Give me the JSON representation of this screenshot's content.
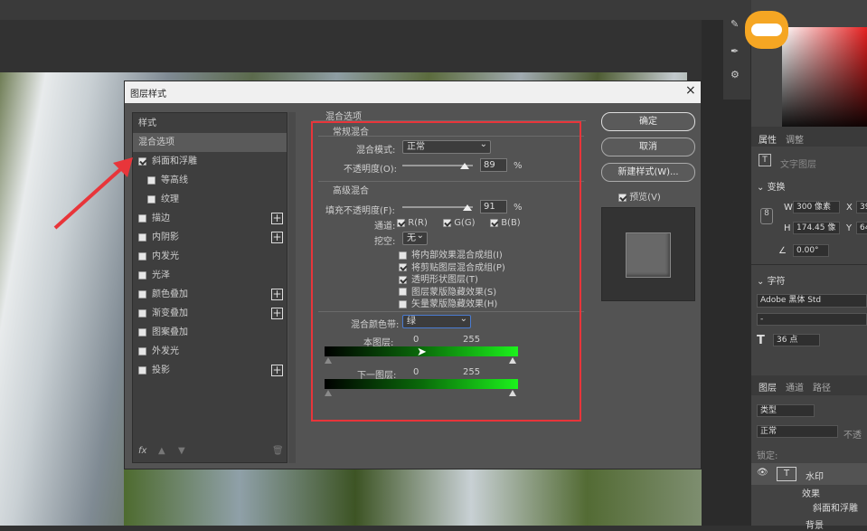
{
  "dialog": {
    "title": "图层样式",
    "close": "×",
    "styles_header": "样式",
    "blend_options": "混合选项",
    "items": [
      {
        "label": "斜面和浮雕",
        "checked": true,
        "plus": false,
        "indent": 0
      },
      {
        "label": "等高线",
        "checked": false,
        "plus": false,
        "indent": 1
      },
      {
        "label": "纹理",
        "checked": false,
        "plus": false,
        "indent": 1
      },
      {
        "label": "描边",
        "checked": false,
        "plus": true,
        "indent": 0
      },
      {
        "label": "内阴影",
        "checked": false,
        "plus": true,
        "indent": 0
      },
      {
        "label": "内发光",
        "checked": false,
        "plus": false,
        "indent": 0
      },
      {
        "label": "光泽",
        "checked": false,
        "plus": false,
        "indent": 0
      },
      {
        "label": "颜色叠加",
        "checked": false,
        "plus": true,
        "indent": 0
      },
      {
        "label": "渐变叠加",
        "checked": false,
        "plus": true,
        "indent": 0
      },
      {
        "label": "图案叠加",
        "checked": false,
        "plus": false,
        "indent": 0
      },
      {
        "label": "外发光",
        "checked": false,
        "plus": false,
        "indent": 0
      },
      {
        "label": "投影",
        "checked": false,
        "plus": true,
        "indent": 0
      }
    ],
    "fx": "fx",
    "section_title": "混合选项",
    "general": {
      "title": "常规混合",
      "mode_label": "混合模式:",
      "mode_value": "正常",
      "opacity_label": "不透明度(O):",
      "opacity_value": "89",
      "unit": "%"
    },
    "advanced": {
      "title": "高级混合",
      "fill_label": "填充不透明度(F):",
      "fill_value": "91",
      "unit": "%",
      "channels_label": "通道:",
      "channels": [
        "R(R)",
        "G(G)",
        "B(B)"
      ],
      "knockout_label": "挖空:",
      "knockout_value": "无",
      "options": [
        {
          "label": "将内部效果混合成组(I)",
          "checked": false
        },
        {
          "label": "将剪贴图层混合成组(P)",
          "checked": true
        },
        {
          "label": "透明形状图层(T)",
          "checked": true
        },
        {
          "label": "图层蒙版隐藏效果(S)",
          "checked": false
        },
        {
          "label": "矢量蒙版隐藏效果(H)",
          "checked": false
        }
      ]
    },
    "blend_if": {
      "label": "混合颜色带:",
      "value": "绿",
      "this_layer": "本图层:",
      "under_layer": "下一图层:",
      "min": "0",
      "max": "255"
    },
    "buttons": {
      "ok": "确定",
      "cancel": "取消",
      "new_style": "新建样式(W)...",
      "preview": "预览(V)"
    }
  },
  "right_panel": {
    "tab_properties": "属性",
    "tab_adjust": "调整",
    "text_layer": "文字图层",
    "transform": "变换",
    "w_label": "W",
    "w_value": "300 像素",
    "x_label": "X",
    "x_value": "39",
    "h_label": "H",
    "h_value": "174.45 像",
    "y_label": "Y",
    "y_value": "64",
    "angle": "0.00°",
    "char_title": "字符",
    "font": "Adobe 黑体 Std",
    "font_style": "-",
    "size": "36 点",
    "layers_tabs": [
      "图层",
      "通道",
      "路径"
    ],
    "search": "类型",
    "mode": "正常",
    "opacity_lbl": "不透",
    "lock": "锁定:",
    "layer1": "水印",
    "effects": "效果",
    "effect1": "斜面和浮雕",
    "bg": "背景"
  },
  "colors": {
    "accent_red": "#e8353a",
    "green": "#1cf21c"
  }
}
